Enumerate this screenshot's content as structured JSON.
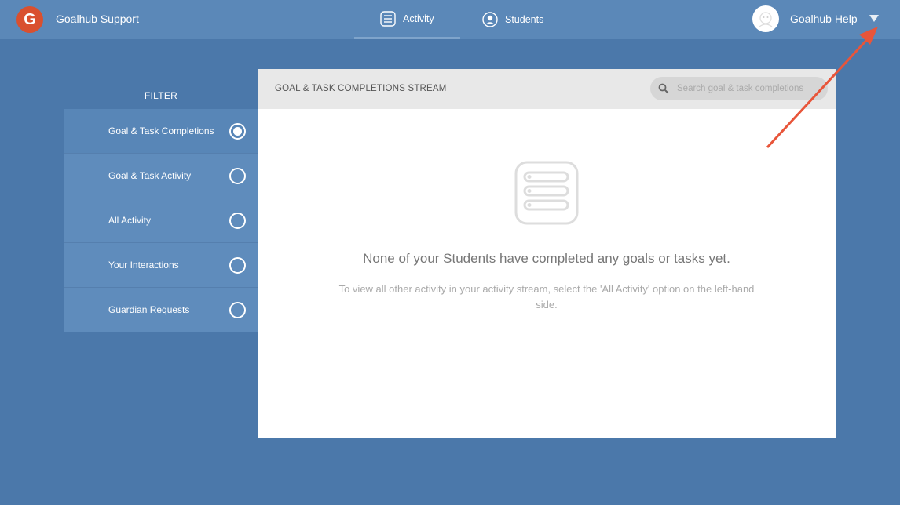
{
  "app": {
    "brand_initial": "G",
    "brand_name": "Goalhub Support"
  },
  "nav": {
    "tabs": [
      {
        "label": "Activity",
        "icon": "activity-list-icon",
        "active": true
      },
      {
        "label": "Students",
        "icon": "user-icon",
        "active": false
      }
    ]
  },
  "user": {
    "name": "Goalhub Help",
    "avatar_icon": "avatar-icon",
    "menu_icon": "chevron-down-icon"
  },
  "filter": {
    "title": "FILTER",
    "items": [
      {
        "label": "Goal & Task Completions",
        "selected": true
      },
      {
        "label": "Goal & Task Activity",
        "selected": false
      },
      {
        "label": "All Activity",
        "selected": false
      },
      {
        "label": "Your Interactions",
        "selected": false
      },
      {
        "label": "Guardian Requests",
        "selected": false
      }
    ]
  },
  "stream": {
    "title": "GOAL & TASK COMPLETIONS STREAM",
    "search_placeholder": "Search goal & task completions",
    "empty_icon": "list-icon",
    "empty_heading": "None of your Students have completed any goals or tasks yet.",
    "empty_subtext": "To view all other activity in your activity stream, select the 'All Activity' option on the left-hand side."
  },
  "colors": {
    "background": "#4b78aa",
    "topbar": "#5b88b8",
    "brand": "#d9502f",
    "annotation_arrow": "#e8553a"
  }
}
